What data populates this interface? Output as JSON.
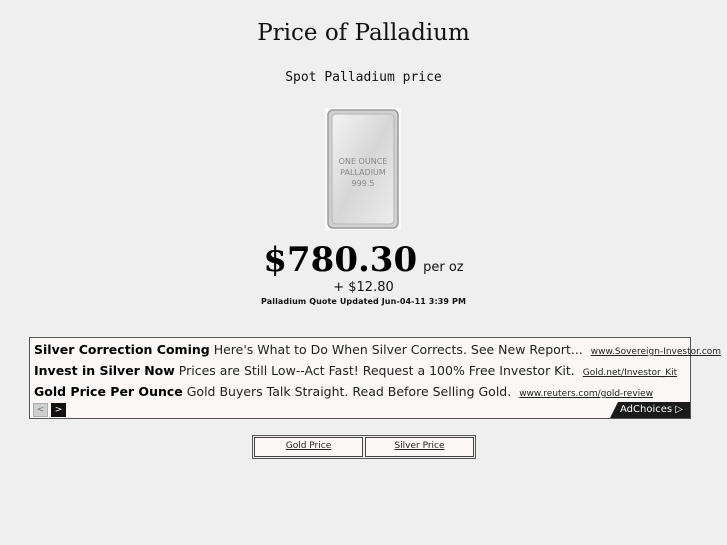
{
  "page": {
    "title": "Price of Palladium",
    "subtitle": "Spot Palladium price"
  },
  "bar_image": {
    "line1": "ONE OUNCE",
    "line2": "PALLADIUM",
    "line3": "999.5"
  },
  "quote": {
    "price": "$780.30",
    "unit": "per oz",
    "change": "+ $12.80",
    "updated": "Palladium Quote Updated Jun-04-11 3:39 PM"
  },
  "ads": {
    "items": [
      {
        "headline": "Silver Correction Coming",
        "text": "Here's What to Do When Silver Corrects. See New Report...",
        "url": "www.Sovereign-Investor.com"
      },
      {
        "headline": "Invest in Silver Now",
        "text": "Prices are Still Low--Act Fast! Request a 100% Free Investor Kit.",
        "url": "Gold.net/Investor_Kit"
      },
      {
        "headline": "Gold Price Per Ounce",
        "text": "Gold Buyers Talk Straight. Read Before Selling Gold.",
        "url": "www.reuters.com/gold-review"
      }
    ],
    "prev_label": "<",
    "next_label": ">",
    "adchoices_label": "AdChoices ▷"
  },
  "links": {
    "gold": "Gold Price",
    "silver": "Silver Price"
  }
}
